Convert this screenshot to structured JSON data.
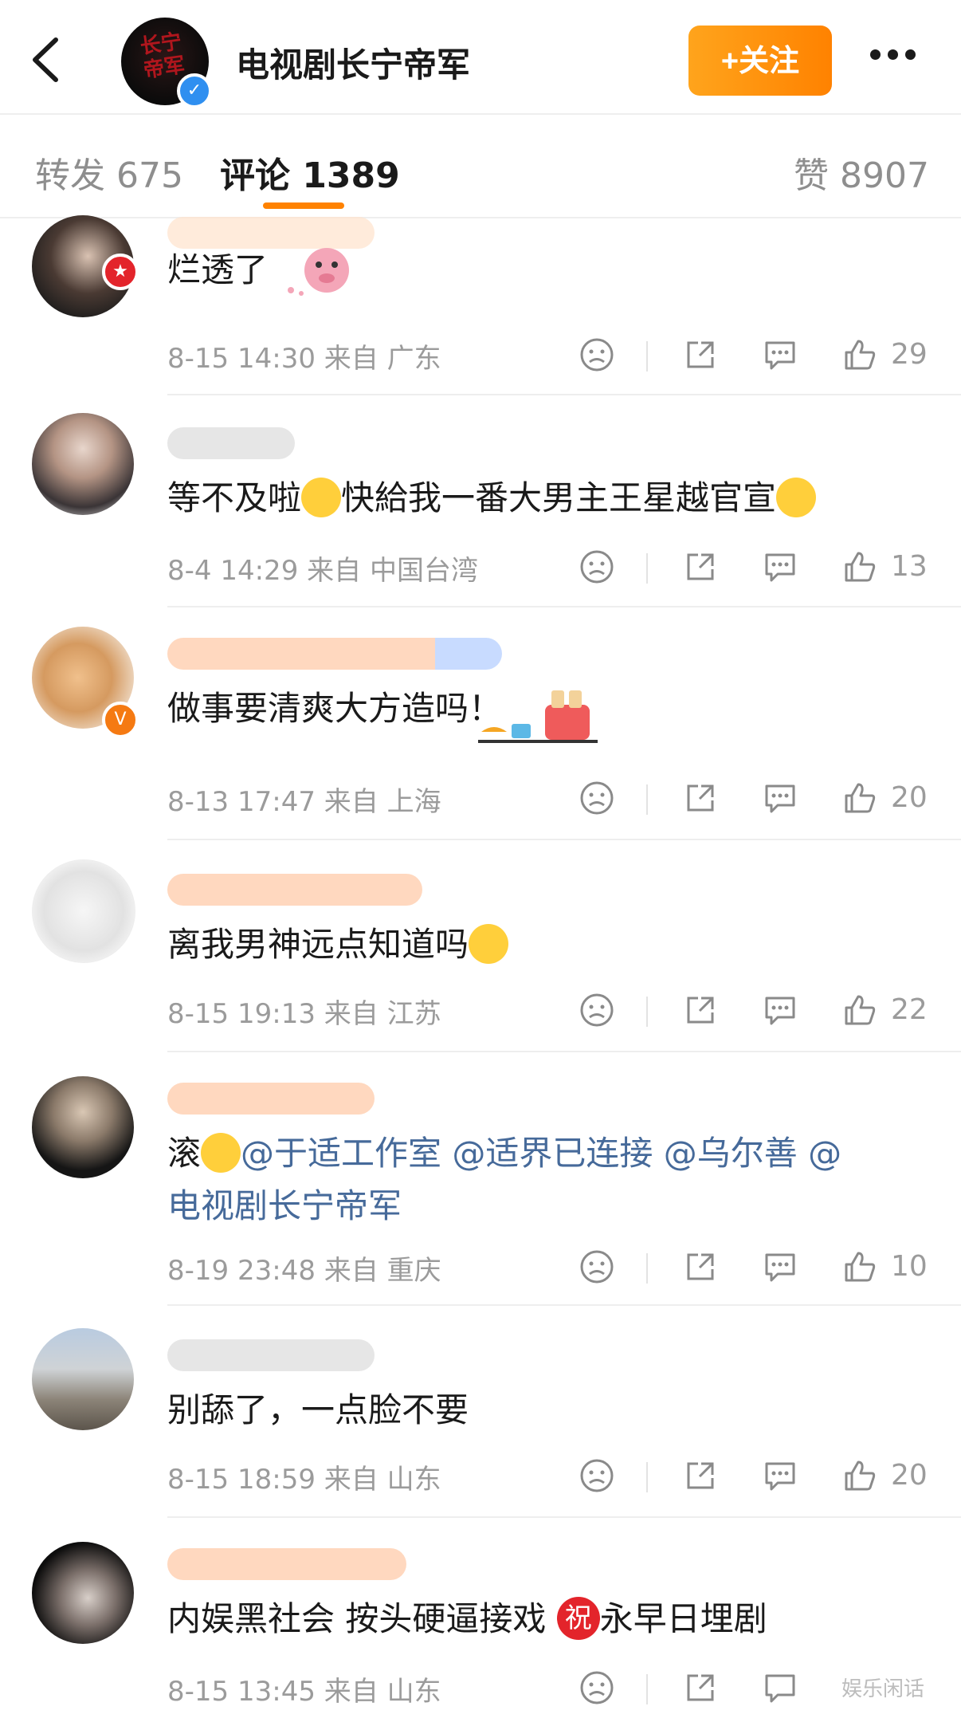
{
  "header": {
    "title": "电视剧长宁帝军",
    "follow_label": "+关注",
    "avatar_text": "长宁帝军"
  },
  "tabs": [
    {
      "label": "转发 675"
    },
    {
      "label": "评论 1389"
    },
    {
      "label": "赞 8907"
    }
  ],
  "comments": [
    {
      "text": "烂透了",
      "date": "8-15 14:30",
      "from": "来自 广东",
      "likes": "29"
    },
    {
      "text": "等不及啦",
      "text2": "快給我一番大男主王星越官宣",
      "date": "8-4 14:29",
      "from": "来自 中国台湾",
      "likes": "13"
    },
    {
      "text": "做事要清爽大方造吗！",
      "date": "8-13 17:47",
      "from": "来自 上海",
      "likes": "20"
    },
    {
      "text": "离我男神远点知道吗",
      "date": "8-15 19:13",
      "from": "来自 江苏",
      "likes": "22"
    },
    {
      "text": "滚",
      "mentions": "@于适工作室 @适界已连接 @乌尔善 @",
      "line2": "电视剧长宁帝军",
      "date": "8-19 23:48",
      "from": "来自 重庆",
      "likes": "10"
    },
    {
      "text": "别舔了，一点脸不要",
      "date": "8-15 18:59",
      "from": "来自 山东",
      "likes": "20"
    },
    {
      "text": "内娱黑社会 按头硬逼接戏",
      "zhu": "祝",
      "text2": "永早日埋剧",
      "date": "8-15 13:45",
      "from": "来自 山东"
    }
  ],
  "watermark": "娱乐闲话",
  "colors": {
    "accent": "#ff8200",
    "mention": "#466a9a",
    "meta": "#9b9b9b",
    "verify_blue": "#2f8ff0",
    "badge_red": "#e3242b",
    "badge_orange": "#f57a12"
  }
}
